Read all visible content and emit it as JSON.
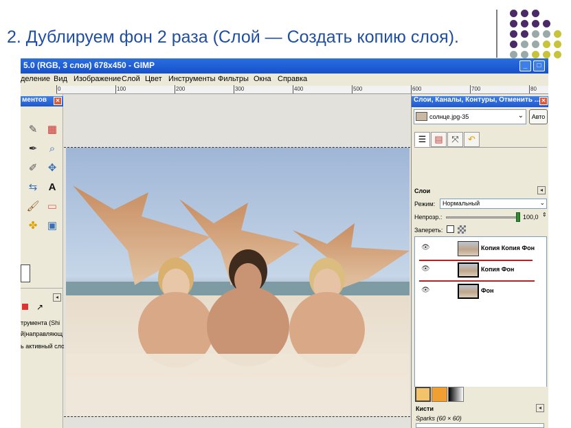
{
  "slide": {
    "title": "2. Дублируем фон 2 раза (Слой — Создать копию слоя).",
    "dot_colors": [
      "#4a2a67",
      "#9aa9a9",
      "#c7c43b"
    ]
  },
  "window": {
    "title": "5.0 (RGB, 3 слоя) 678x450 - GIMP",
    "menu": [
      "деление",
      "Вид",
      "Изображение",
      "Слой",
      "Цвет",
      "Инструменты",
      "Фильтры",
      "Окна",
      "Справка"
    ],
    "ruler_ticks": [
      "0",
      "100",
      "200",
      "300",
      "400",
      "500",
      "600",
      "700",
      "80"
    ]
  },
  "toolbox": {
    "title": "ментов",
    "texts": [
      "трумента (Shi",
      "й|направляющ",
      "ь активный сло"
    ]
  },
  "dock": {
    "title": "Слои, Каналы, Контуры, Отменить ...",
    "image_name": "солнце.jpg-35",
    "auto_label": "Авто",
    "panel_title": "Слои",
    "mode_label": "Режим:",
    "mode_value": "Нормальный",
    "opacity_label": "Непрозр.:",
    "opacity_value": "100,0",
    "lock_label": "Запереть:",
    "layers": [
      {
        "name": "Копия Копия Фон"
      },
      {
        "name": "Копия Фон"
      },
      {
        "name": "Фон"
      }
    ],
    "brushes_label": "Кисти",
    "brush_name": "Sparks (60 × 60)"
  }
}
